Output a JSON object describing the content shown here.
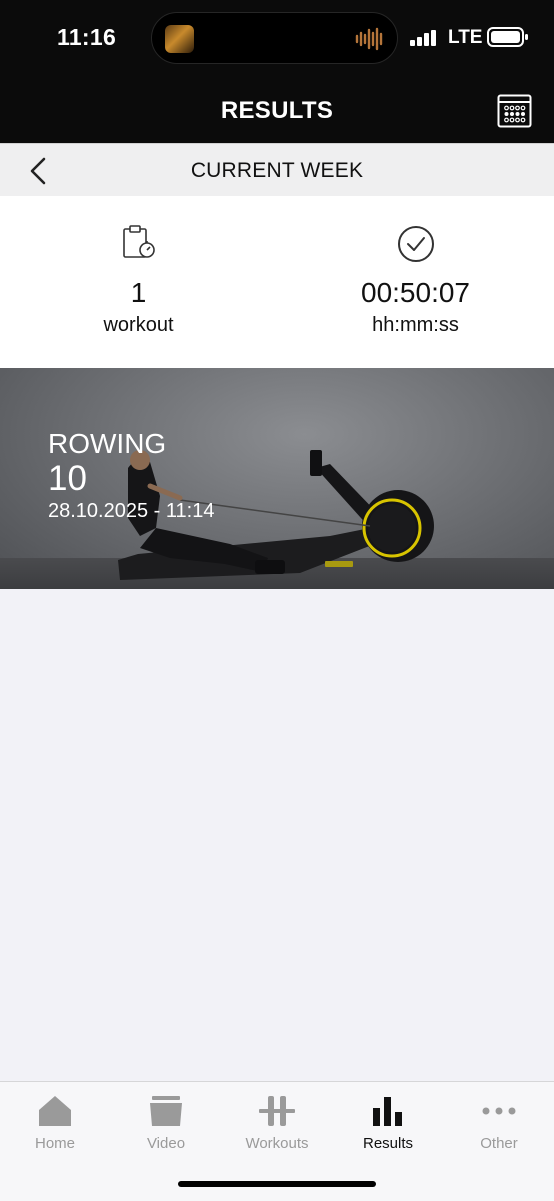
{
  "status_bar": {
    "time": "11:16",
    "network": "LTE"
  },
  "header": {
    "title": "RESULTS"
  },
  "week_bar": {
    "title": "CURRENT WEEK"
  },
  "summary": {
    "workouts_value": "1",
    "workouts_unit": "workout",
    "duration_value": "00:50:07",
    "duration_unit": "hh:mm:ss"
  },
  "results": [
    {
      "name": "ROWING",
      "value": "10",
      "date": "28.10.2025 - 11:14"
    }
  ],
  "tabs": [
    {
      "label": "Home",
      "icon": "home-icon",
      "active": false
    },
    {
      "label": "Video",
      "icon": "video-folder-icon",
      "active": false
    },
    {
      "label": "Workouts",
      "icon": "barbell-icon",
      "active": false
    },
    {
      "label": "Results",
      "icon": "bar-chart-icon",
      "active": true
    },
    {
      "label": "Other",
      "icon": "more-dots-icon",
      "active": false
    }
  ],
  "colors": {
    "header_bg": "#0b0b0b",
    "rower_accent": "#d8c400",
    "active_tab": "#111111",
    "inactive_tab": "#9a9a9a"
  }
}
